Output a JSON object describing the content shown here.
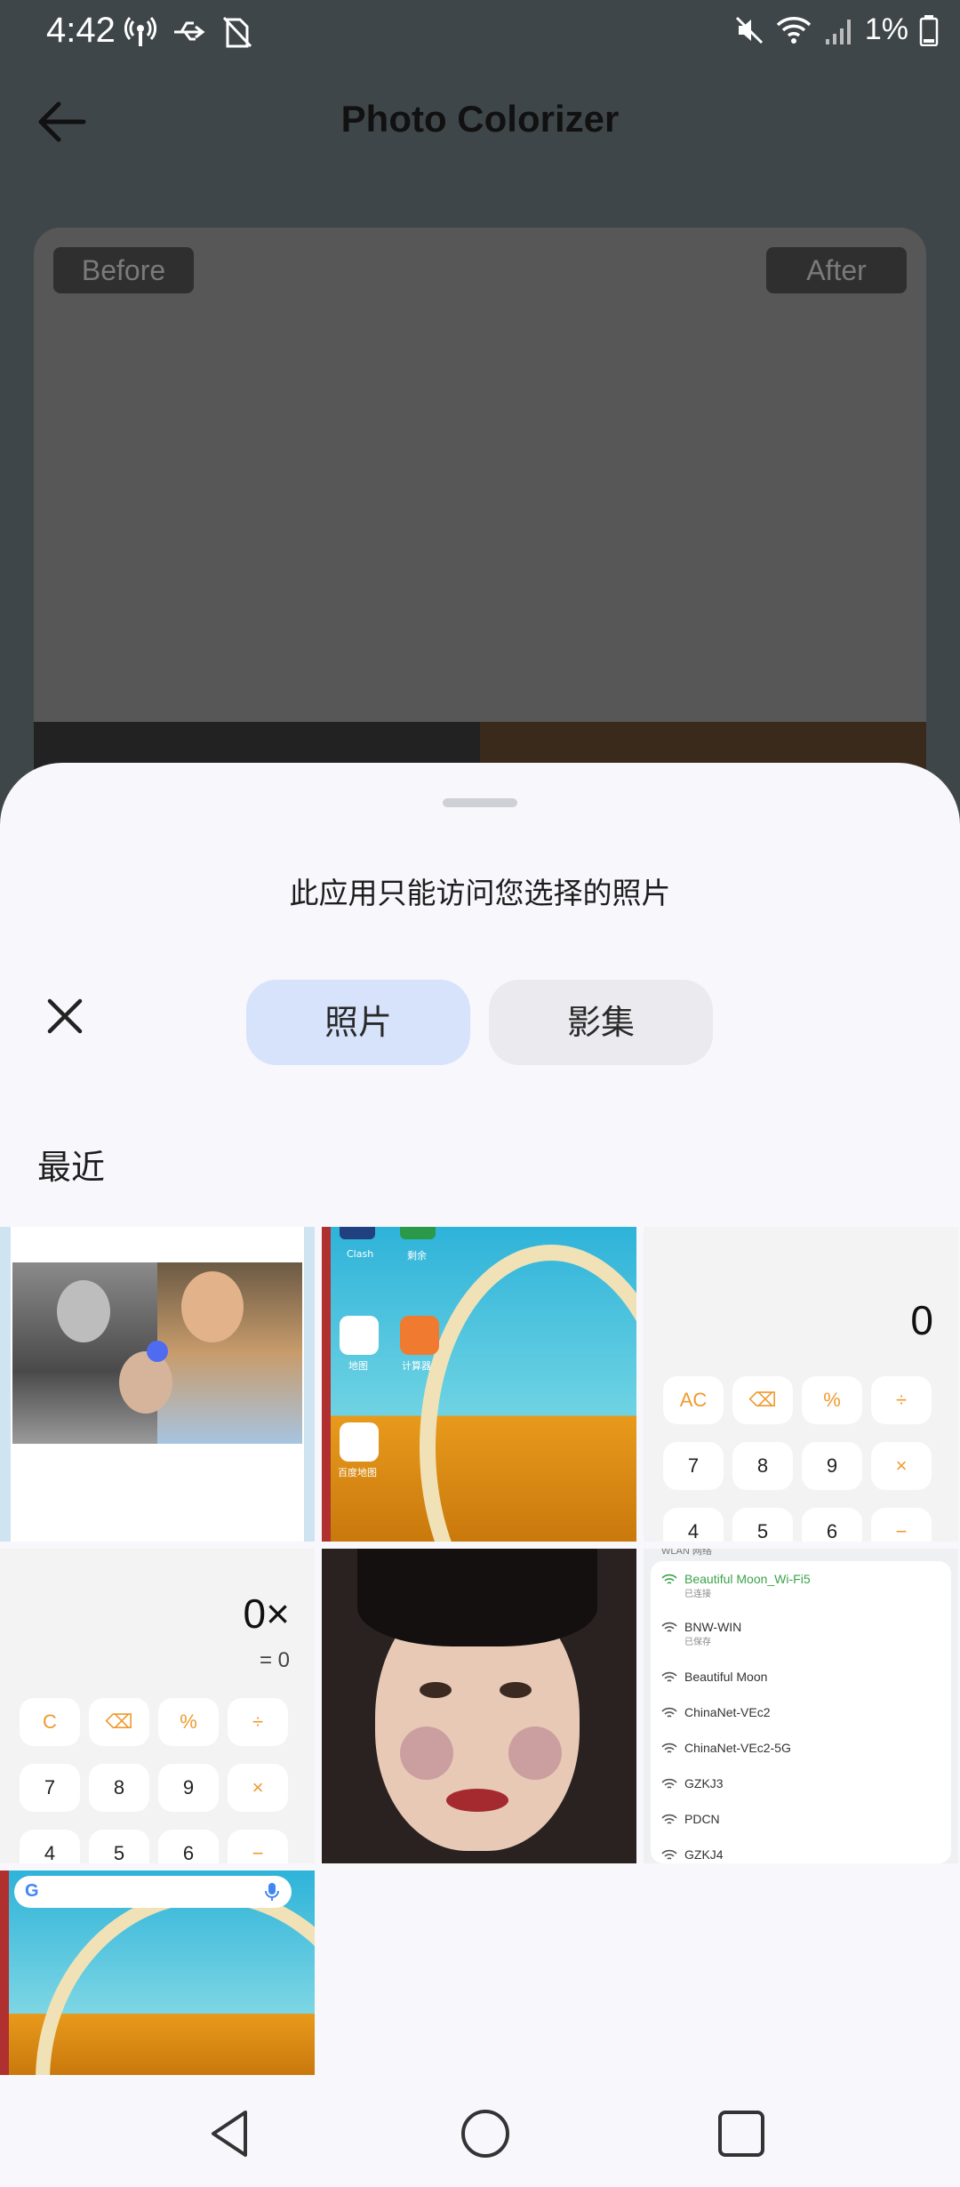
{
  "status_bar": {
    "time": "4:42",
    "battery_pct": "1%"
  },
  "app_bar": {
    "title": "Photo Colorizer"
  },
  "compare": {
    "before_label": "Before",
    "after_label": "After"
  },
  "sheet": {
    "title": "此应用只能访问您选择的照片",
    "tabs": [
      {
        "label": "照片",
        "selected": true
      },
      {
        "label": "影集",
        "selected": false
      }
    ],
    "section_label": "最近"
  },
  "thumbs": {
    "home_apps": [
      "Clash",
      "剩余",
      "地图",
      "计算器",
      "百度地图"
    ],
    "calc1": {
      "display": "0",
      "keys": [
        "AC",
        "⌫",
        "%",
        "÷",
        "7",
        "8",
        "9",
        "×",
        "4",
        "5",
        "6",
        "−"
      ]
    },
    "calc2": {
      "display": "0×",
      "result": "= 0",
      "keys": [
        "C",
        "⌫",
        "%",
        "÷",
        "7",
        "8",
        "9",
        "×",
        "4",
        "5",
        "6",
        "−"
      ]
    },
    "wifi": {
      "header": "WLAN 网络",
      "networks": [
        {
          "name": "Beautiful Moon_Wi-Fi5",
          "sub": "已连接",
          "active": true
        },
        {
          "name": "BNW-WIN",
          "sub": "已保存"
        },
        {
          "name": "Beautiful Moon"
        },
        {
          "name": "ChinaNet-VEc2"
        },
        {
          "name": "ChinaNet-VEc2-5G"
        },
        {
          "name": "GZKJ3"
        },
        {
          "name": "PDCN"
        },
        {
          "name": "GZKJ4"
        }
      ]
    }
  },
  "colors": {
    "sheet_bg": "#f8f7fb",
    "tab_selected": "#d6e3fb",
    "accent_orange": "#ef9a2d",
    "wifi_green": "#3aa34a"
  }
}
